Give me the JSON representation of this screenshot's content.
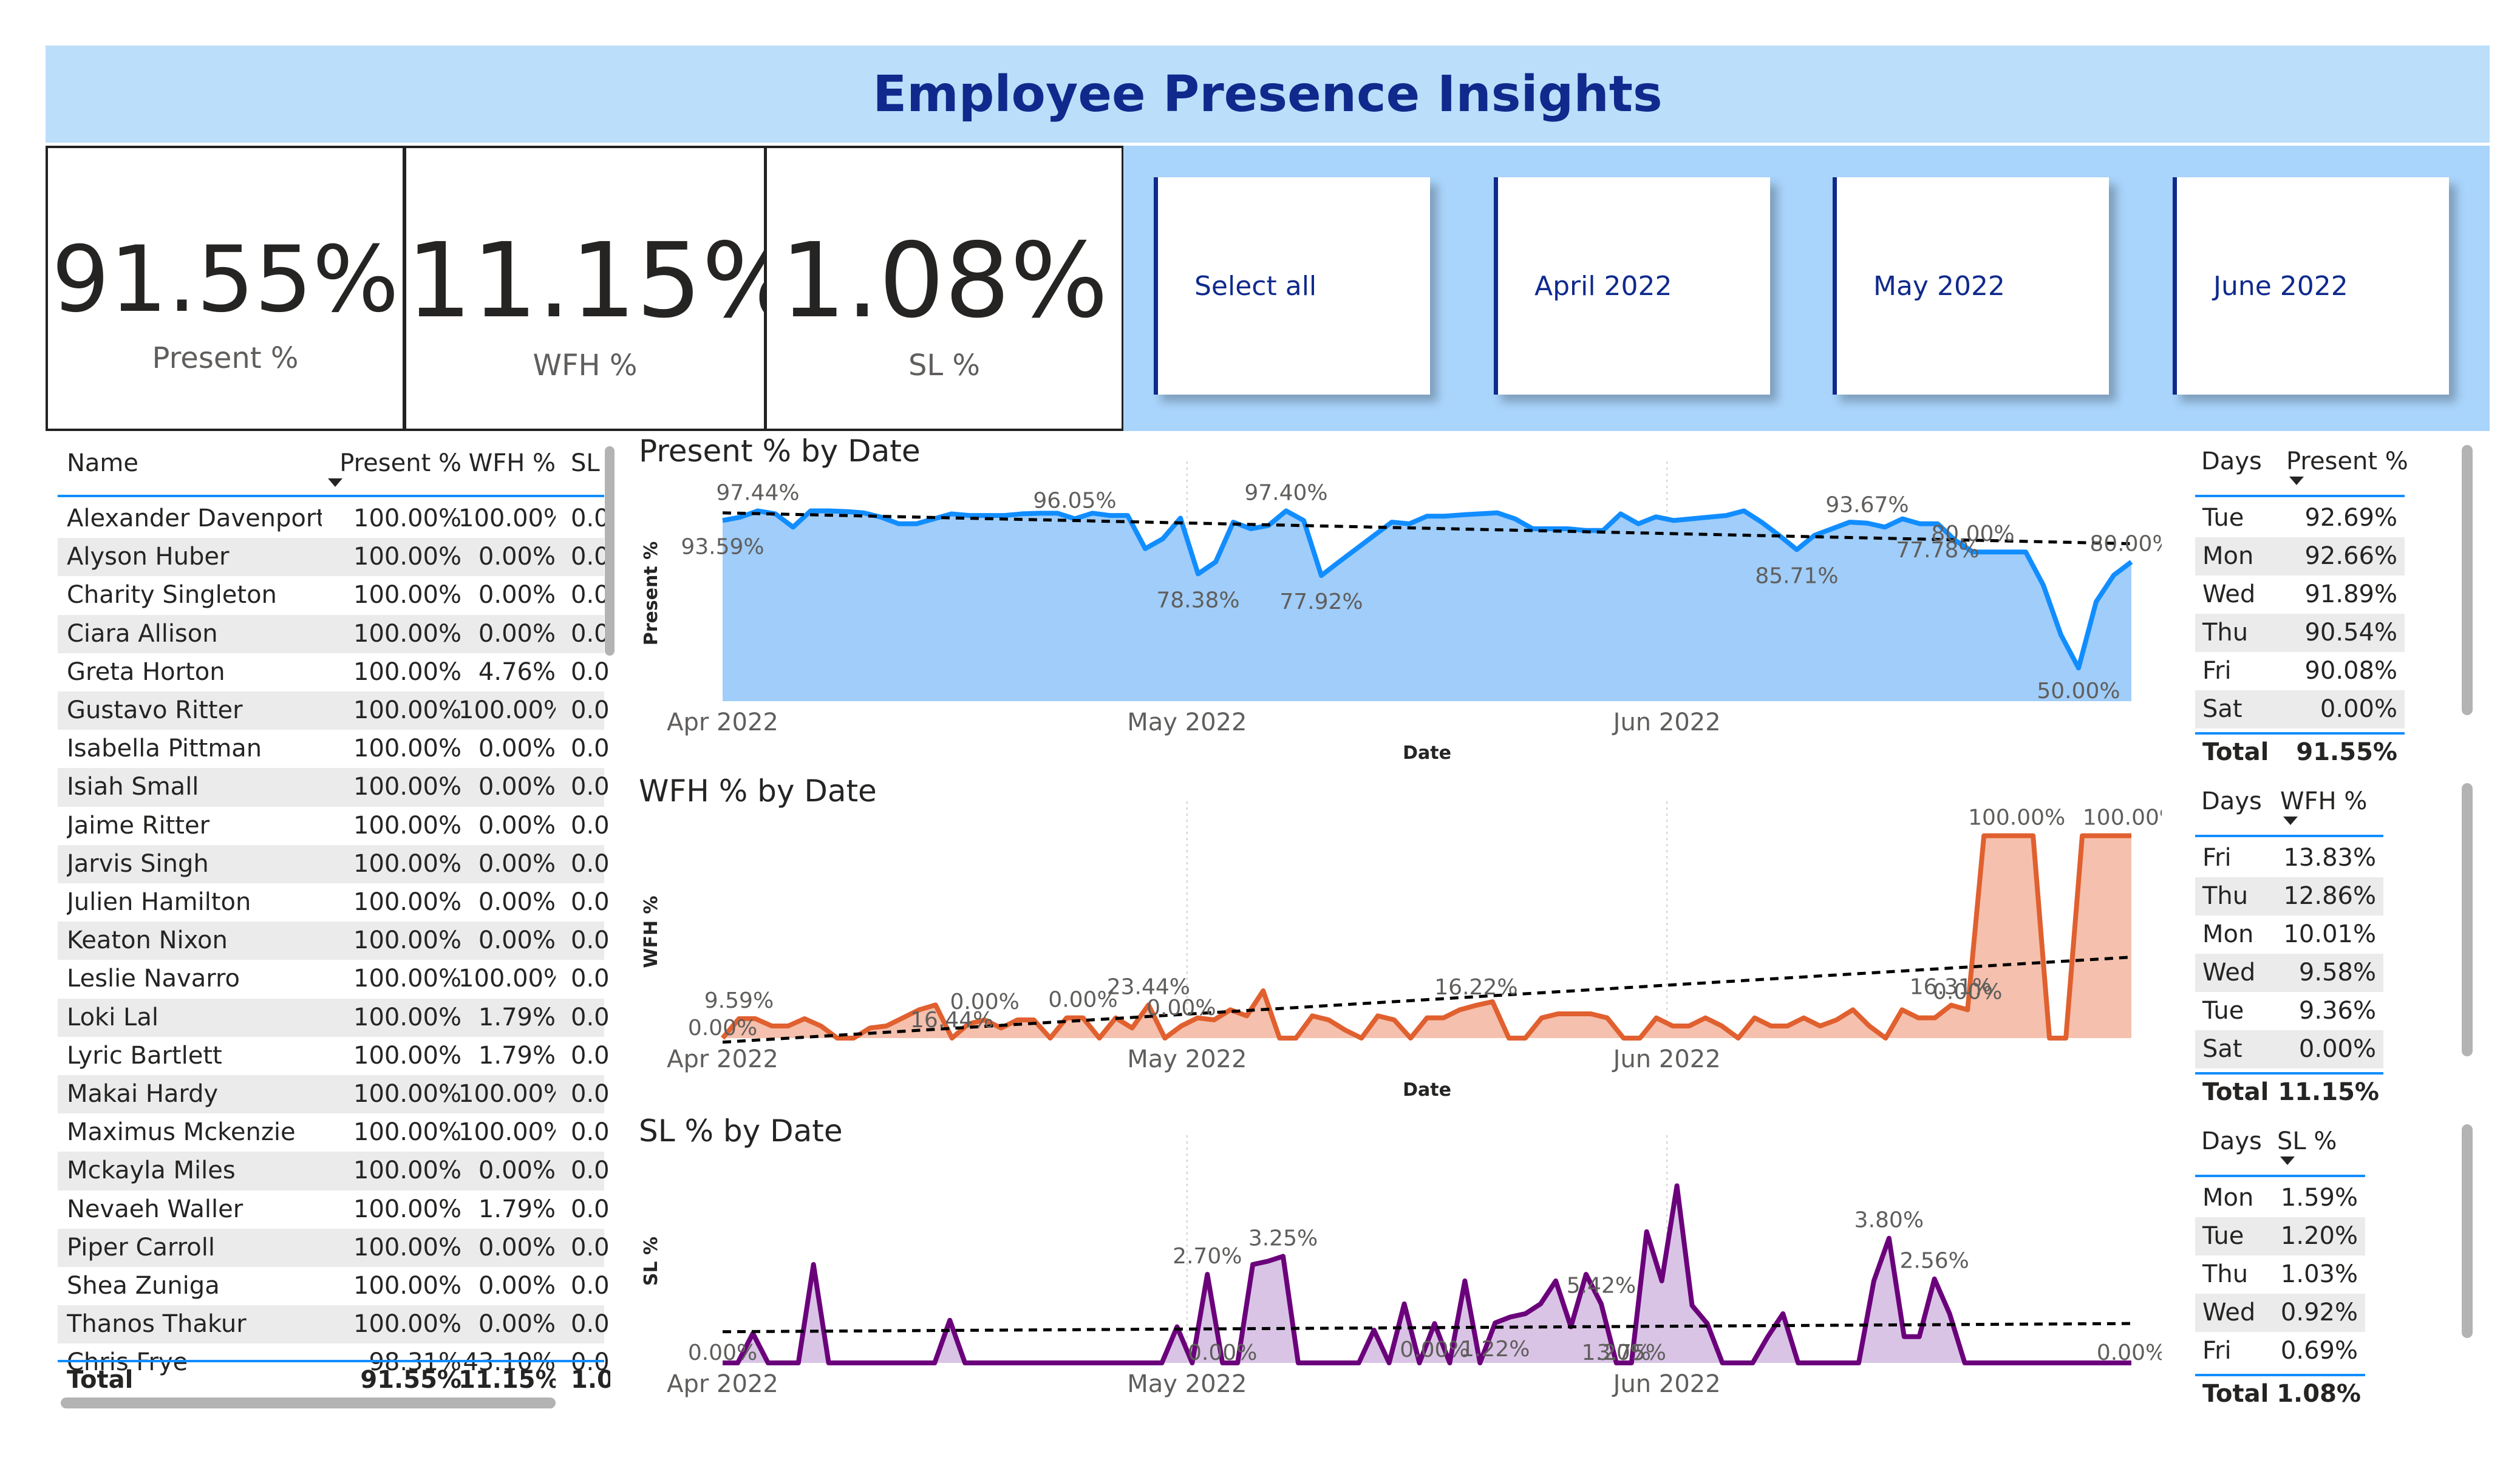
{
  "title": "Employee Presence Insights",
  "kpis": [
    {
      "value": "91.55%",
      "label": "Present %"
    },
    {
      "value": "11.15%",
      "label": "WFH %"
    },
    {
      "value": "1.08%",
      "label": "SL %"
    }
  ],
  "slicer": {
    "options": [
      "Select all",
      "April 2022",
      "May 2022",
      "June 2022"
    ]
  },
  "employee_table": {
    "columns": [
      "Name",
      "Present %",
      "WFH %",
      "SL"
    ],
    "rows": [
      [
        "Alexander Davenport",
        "100.00%",
        "100.00%",
        "0.0"
      ],
      [
        "Alyson Huber",
        "100.00%",
        "0.00%",
        "0.0"
      ],
      [
        "Charity Singleton",
        "100.00%",
        "0.00%",
        "0.0"
      ],
      [
        "Ciara Allison",
        "100.00%",
        "0.00%",
        "0.0"
      ],
      [
        "Greta Horton",
        "100.00%",
        "4.76%",
        "0.0"
      ],
      [
        "Gustavo Ritter",
        "100.00%",
        "100.00%",
        "0.0"
      ],
      [
        "Isabella Pittman",
        "100.00%",
        "0.00%",
        "0.0"
      ],
      [
        "Isiah Small",
        "100.00%",
        "0.00%",
        "0.0"
      ],
      [
        "Jaime Ritter",
        "100.00%",
        "0.00%",
        "0.0"
      ],
      [
        "Jarvis Singh",
        "100.00%",
        "0.00%",
        "0.0"
      ],
      [
        "Julien Hamilton",
        "100.00%",
        "0.00%",
        "0.0"
      ],
      [
        "Keaton Nixon",
        "100.00%",
        "0.00%",
        "0.0"
      ],
      [
        "Leslie Navarro",
        "100.00%",
        "100.00%",
        "0.0"
      ],
      [
        "Loki Lal",
        "100.00%",
        "1.79%",
        "0.0"
      ],
      [
        "Lyric Bartlett",
        "100.00%",
        "1.79%",
        "0.0"
      ],
      [
        "Makai Hardy",
        "100.00%",
        "100.00%",
        "0.0"
      ],
      [
        "Maximus Mckenzie",
        "100.00%",
        "100.00%",
        "0.0"
      ],
      [
        "Mckayla Miles",
        "100.00%",
        "0.00%",
        "0.0"
      ],
      [
        "Nevaeh Waller",
        "100.00%",
        "1.79%",
        "0.0"
      ],
      [
        "Piper Carroll",
        "100.00%",
        "0.00%",
        "0.0"
      ],
      [
        "Shea Zuniga",
        "100.00%",
        "0.00%",
        "0.0"
      ],
      [
        "Thanos Thakur",
        "100.00%",
        "0.00%",
        "0.0"
      ],
      [
        "Chris Frye",
        "98.31%",
        "43.10%",
        "0.0"
      ]
    ],
    "total": [
      "Total",
      "91.55%",
      "11.15%",
      "1.0"
    ]
  },
  "present_days": {
    "columns": [
      "Days",
      "Present %"
    ],
    "rows": [
      [
        "Tue",
        "92.69%"
      ],
      [
        "Mon",
        "92.66%"
      ],
      [
        "Wed",
        "91.89%"
      ],
      [
        "Thu",
        "90.54%"
      ],
      [
        "Fri",
        "90.08%"
      ],
      [
        "Sat",
        "0.00%"
      ]
    ],
    "total": [
      "Total",
      "91.55%"
    ]
  },
  "wfh_days": {
    "columns": [
      "Days",
      "WFH %"
    ],
    "rows": [
      [
        "Fri",
        "13.83%"
      ],
      [
        "Thu",
        "12.86%"
      ],
      [
        "Mon",
        "10.01%"
      ],
      [
        "Wed",
        "9.58%"
      ],
      [
        "Tue",
        "9.36%"
      ],
      [
        "Sat",
        "0.00%"
      ]
    ],
    "total": [
      "Total",
      "11.15%"
    ]
  },
  "sl_days": {
    "columns": [
      "Days",
      "SL %"
    ],
    "rows": [
      [
        "Mon",
        "1.59%"
      ],
      [
        "Tue",
        "1.20%"
      ],
      [
        "Thu",
        "1.03%"
      ],
      [
        "Wed",
        "0.92%"
      ],
      [
        "Fri",
        "0.69%"
      ]
    ],
    "total": [
      "Total",
      "1.08%"
    ]
  },
  "chart_data": [
    {
      "type": "area",
      "title": "Present % by Date",
      "xlabel": "Date",
      "ylabel": "Present %",
      "x_ticks": [
        "Apr 2022",
        "May 2022",
        "Jun 2022"
      ],
      "x_start": "2022-04-01",
      "x_end": "2022-06-30",
      "ylim": [
        40,
        105
      ],
      "color": "#118dff",
      "fill": "#a0cdf9",
      "trend": [
        96.8,
        87.5
      ],
      "values": [
        94.5,
        95.5,
        97.4,
        96.5,
        92.5,
        97.4,
        97.4,
        97.2,
        96.8,
        95.5,
        93.5,
        93.5,
        95.0,
        96.5,
        96.0,
        96.0,
        96.0,
        96.5,
        96.7,
        96.7,
        95.0,
        96.7,
        96.0,
        96.0,
        86.0,
        89.0,
        95.2,
        78.4,
        82.0,
        94.0,
        92.0,
        93.0,
        97.4,
        94.5,
        77.9,
        82.0,
        86.0,
        90.0,
        94.0,
        93.5,
        95.8,
        95.8,
        96.2,
        96.5,
        96.8,
        95.0,
        92.0,
        92.0,
        92.0,
        91.5,
        91.5,
        96.5,
        93.5,
        95.6,
        94.5,
        95.0,
        95.5,
        96.0,
        97.4,
        94.0,
        90.0,
        85.7,
        90.0,
        92.0,
        94.0,
        93.7,
        92.5,
        95.0,
        93.5,
        93.5,
        88.5,
        85.0,
        85.0,
        85.0,
        85.0,
        75.0,
        60.0,
        50.0,
        70.0,
        78.0,
        82.0
      ],
      "labels": [
        {
          "i": 0,
          "text": "93.59%"
        },
        {
          "i": 2,
          "text": "97.44%"
        },
        {
          "i": 20,
          "text": "96.05%"
        },
        {
          "i": 27,
          "text": "78.38%"
        },
        {
          "i": 32,
          "text": "97.40%"
        },
        {
          "i": 34,
          "text": "77.92%"
        },
        {
          "i": 61,
          "text": "85.71%"
        },
        {
          "i": 65,
          "text": "93.67%"
        },
        {
          "i": 69,
          "text": "77.78%"
        },
        {
          "i": 71,
          "text": "80.00%"
        },
        {
          "i": 77,
          "text": "50.00%"
        },
        {
          "i": 80,
          "text": "80.00%"
        }
      ]
    },
    {
      "type": "area",
      "title": "WFH % by Date",
      "xlabel": "Date",
      "ylabel": "WFH %",
      "x_ticks": [
        "Apr 2022",
        "May 2022",
        "Jun 2022"
      ],
      "x_start": "2022-04-01",
      "x_end": "2022-06-30",
      "ylim": [
        0,
        105
      ],
      "color": "#e0602f",
      "fill": "#f5c0ad",
      "trend": [
        -2.0,
        40.0
      ],
      "values": [
        0.0,
        9.6,
        9.6,
        6.0,
        6.0,
        9.6,
        6.0,
        0.0,
        0.0,
        5.0,
        6.0,
        10.0,
        14.0,
        16.4,
        0.0,
        7.0,
        9.0,
        5.0,
        9.0,
        9.0,
        0.0,
        10.0,
        10.0,
        0.0,
        10.0,
        5.0,
        16.4,
        0.0,
        6.0,
        10.0,
        9.0,
        14.0,
        11.0,
        23.4,
        0.0,
        0.0,
        11.0,
        9.0,
        4.0,
        0.0,
        11.0,
        9.0,
        0.0,
        10.0,
        10.0,
        14.0,
        16.2,
        18.0,
        0.0,
        0.0,
        10.0,
        12.0,
        12.0,
        12.0,
        10.0,
        0.0,
        0.0,
        10.0,
        6.0,
        6.0,
        10.0,
        6.0,
        0.0,
        10.0,
        6.0,
        6.0,
        10.0,
        6.0,
        9.0,
        14.0,
        6.0,
        0.0,
        14.0,
        10.0,
        10.0,
        16.3,
        14.0,
        100.0,
        100.0,
        100.0,
        100.0,
        0.0,
        0.0,
        100.0,
        100.0,
        100.0,
        100.0
      ],
      "labels": [
        {
          "i": 0,
          "text": "0.00%"
        },
        {
          "i": 1,
          "text": "9.59%"
        },
        {
          "i": 14,
          "text": "16.44%"
        },
        {
          "i": 16,
          "text": "0.00%"
        },
        {
          "i": 22,
          "text": "0.00%"
        },
        {
          "i": 26,
          "text": "23.44%"
        },
        {
          "i": 28,
          "text": "0.00%"
        },
        {
          "i": 46,
          "text": "16.22%"
        },
        {
          "i": 75,
          "text": "16.31%"
        },
        {
          "i": 76,
          "text": "0.00%"
        },
        {
          "i": 79,
          "text": "100.00%"
        },
        {
          "i": 86,
          "text": "100.00%"
        }
      ]
    },
    {
      "type": "area",
      "title": "SL % by Date",
      "xlabel": "",
      "ylabel": "SL %",
      "x_ticks": [
        "Apr 2022",
        "May 2022",
        "Jun 2022"
      ],
      "x_start": "2022-04-01",
      "x_end": "2022-06-30",
      "ylim": [
        0,
        6.2
      ],
      "color": "#6b007b",
      "fill": "#d9c4e6",
      "trend": [
        0.95,
        1.2
      ],
      "values": [
        0.0,
        0.0,
        0.9,
        0.0,
        0.0,
        0.0,
        3.0,
        0.0,
        0.0,
        0.0,
        0.0,
        0.0,
        0.0,
        0.0,
        0.0,
        1.3,
        0.0,
        0.0,
        0.0,
        0.0,
        0.0,
        0.0,
        0.0,
        0.0,
        0.0,
        0.0,
        0.0,
        0.0,
        0.0,
        0.0,
        1.1,
        0.0,
        2.7,
        0.0,
        0.0,
        3.0,
        3.1,
        3.25,
        0.0,
        0.0,
        0.0,
        0.0,
        0.0,
        1.0,
        0.0,
        1.8,
        0.0,
        1.2,
        0.0,
        2.5,
        0.0,
        1.22,
        1.4,
        1.5,
        1.8,
        2.5,
        1.1,
        2.7,
        1.8,
        0.0,
        0.0,
        4.0,
        2.5,
        5.4,
        1.75,
        1.2,
        0.0,
        0.0,
        0.0,
        0.8,
        1.5,
        0.0,
        0.0,
        0.0,
        0.0,
        0.0,
        2.5,
        3.8,
        0.8,
        0.8,
        2.56,
        1.5,
        0.0,
        0.0,
        0.0,
        0.0,
        0.0,
        0.0,
        0.0,
        0.0,
        0.0,
        0.0,
        0.0,
        0.0
      ],
      "labels": [
        {
          "i": 0,
          "text": "0.00%"
        },
        {
          "i": 32,
          "text": "2.70%"
        },
        {
          "i": 33,
          "text": "0.00%"
        },
        {
          "i": 37,
          "text": "3.25%"
        },
        {
          "i": 47,
          "text": "0.00%"
        },
        {
          "i": 51,
          "text": "1.22%"
        },
        {
          "i": 58,
          "text": "5.42%"
        },
        {
          "i": 59,
          "text": "1.20%"
        },
        {
          "i": 60,
          "text": "3.75%"
        },
        {
          "i": 77,
          "text": "3.80%"
        },
        {
          "i": 80,
          "text": "2.56%"
        },
        {
          "i": 93,
          "text": "0.00%"
        }
      ]
    }
  ]
}
